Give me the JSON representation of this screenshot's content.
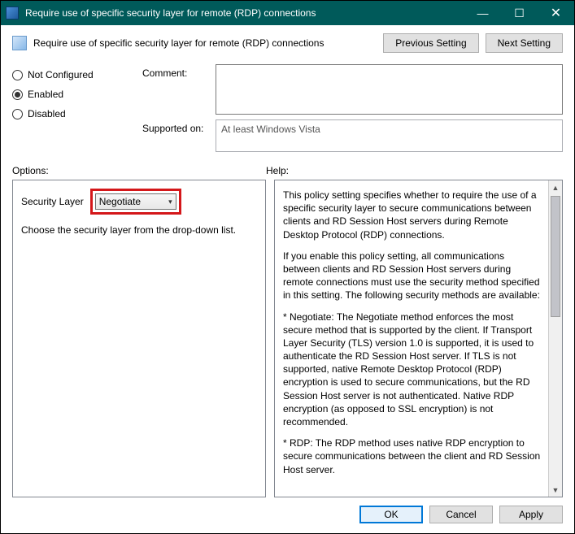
{
  "window": {
    "title": "Require use of specific security layer for remote (RDP) connections",
    "heading": "Require use of specific security layer for remote (RDP) connections",
    "prev_btn": "Previous Setting",
    "next_btn": "Next Setting"
  },
  "state": {
    "not_configured": "Not Configured",
    "enabled": "Enabled",
    "disabled": "Disabled",
    "selected": "enabled"
  },
  "fields": {
    "comment_label": "Comment:",
    "comment_value": "",
    "supported_label": "Supported on:",
    "supported_value": "At least Windows Vista"
  },
  "sections": {
    "options": "Options:",
    "help": "Help:"
  },
  "options": {
    "label": "Security Layer",
    "dropdown_value": "Negotiate",
    "desc": "Choose the security layer from the drop-down list."
  },
  "help": {
    "p1": "This policy setting specifies whether to require the use of a specific security layer to secure communications between clients and RD Session Host servers during Remote Desktop Protocol (RDP) connections.",
    "p2": "If you enable this policy setting, all communications between clients and RD Session Host servers during remote connections must use the security method specified in this setting. The following security methods are available:",
    "p3": "* Negotiate: The Negotiate method enforces the most secure method that is supported by the client. If Transport Layer Security (TLS) version 1.0 is supported, it is used to authenticate the RD Session Host server. If TLS is not supported, native Remote Desktop Protocol (RDP) encryption is used to secure communications, but the RD Session Host server is not authenticated. Native RDP encryption (as opposed to SSL encryption) is not recommended.",
    "p4": "* RDP: The RDP method uses native RDP encryption to secure communications between the client and RD Session Host server."
  },
  "footer": {
    "ok": "OK",
    "cancel": "Cancel",
    "apply": "Apply"
  }
}
